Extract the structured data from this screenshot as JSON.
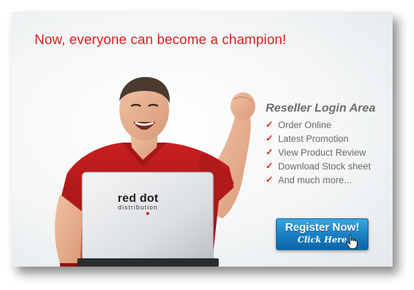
{
  "headline": "Now, everyone can become a champion!",
  "login": {
    "title": "Reseller Login Area",
    "items": [
      {
        "check": "✓",
        "label": "Order Online"
      },
      {
        "check": "✓",
        "label": "Latest Promotion"
      },
      {
        "check": "✓",
        "label": "View Product Review"
      },
      {
        "check": "✓",
        "label": "Download Stock sheet"
      },
      {
        "check": "✓",
        "label": "And much more..."
      }
    ]
  },
  "register": {
    "label": "Register Now!",
    "sublabel": "Click Here"
  },
  "logo": {
    "name": "red dot",
    "tagline": "distribution"
  },
  "colors": {
    "accent_red": "#d9221c",
    "button_blue": "#1a80c4",
    "text_gray": "#6a6a6a"
  }
}
